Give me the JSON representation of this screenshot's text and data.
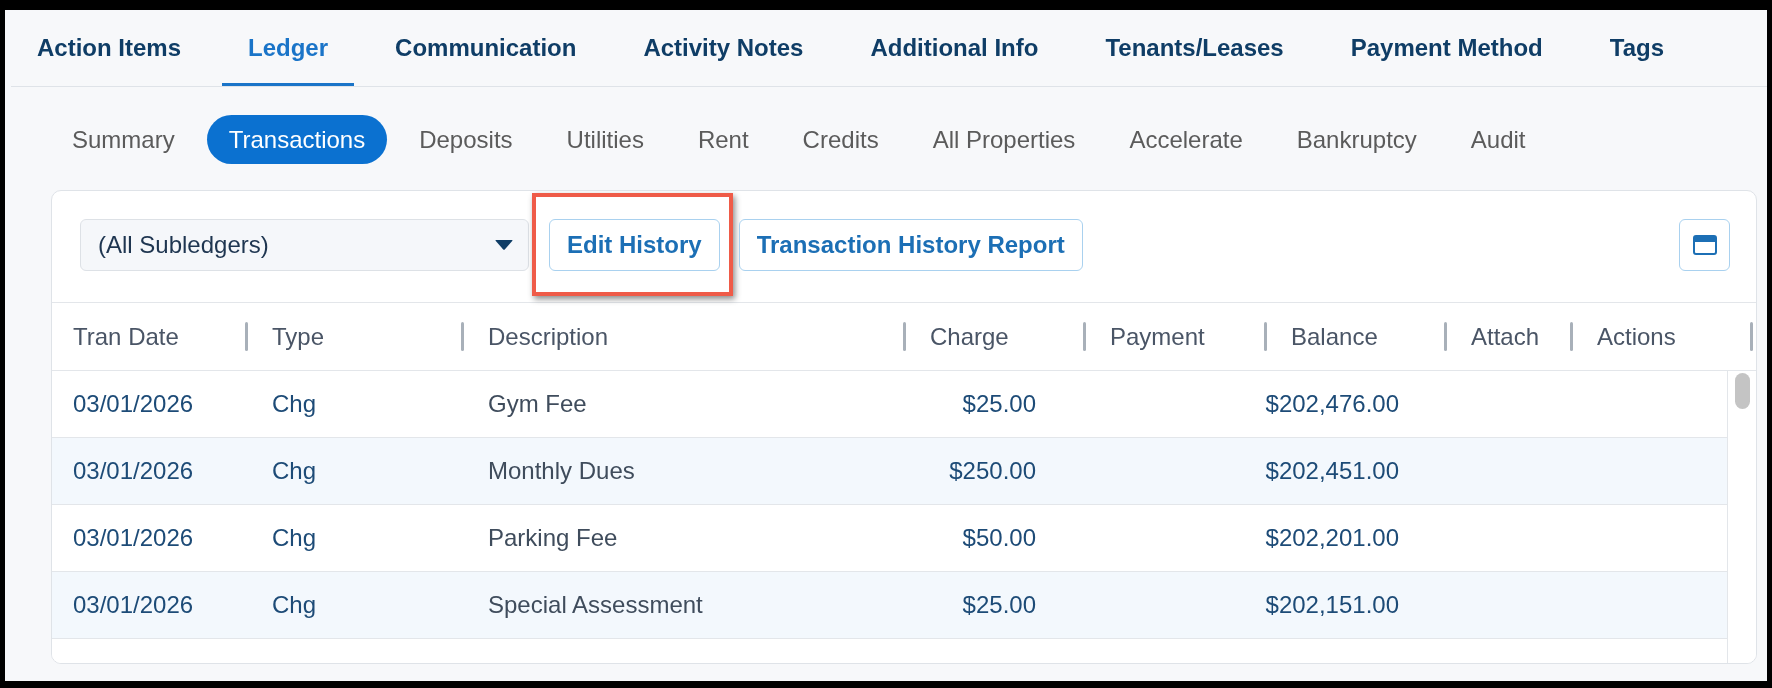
{
  "primary_tabs": [
    {
      "label": "Action Items",
      "selected": false
    },
    {
      "label": "Ledger",
      "selected": true
    },
    {
      "label": "Communication",
      "selected": false
    },
    {
      "label": "Activity Notes",
      "selected": false
    },
    {
      "label": "Additional Info",
      "selected": false
    },
    {
      "label": "Tenants/Leases",
      "selected": false
    },
    {
      "label": "Payment Method",
      "selected": false
    },
    {
      "label": "Tags",
      "selected": false
    }
  ],
  "secondary_tabs": [
    {
      "label": "Summary",
      "selected": false
    },
    {
      "label": "Transactions",
      "selected": true
    },
    {
      "label": "Deposits",
      "selected": false
    },
    {
      "label": "Utilities",
      "selected": false
    },
    {
      "label": "Rent",
      "selected": false
    },
    {
      "label": "Credits",
      "selected": false
    },
    {
      "label": "All Properties",
      "selected": false
    },
    {
      "label": "Accelerate",
      "selected": false
    },
    {
      "label": "Bankruptcy",
      "selected": false
    },
    {
      "label": "Audit",
      "selected": false
    }
  ],
  "toolbar": {
    "subledger_select": {
      "value": "(All Subledgers)"
    },
    "buttons": [
      {
        "label": "Edit History",
        "highlighted": true
      },
      {
        "label": "Transaction History Report",
        "highlighted": false
      }
    ]
  },
  "table": {
    "columns": [
      "Tran Date",
      "Type",
      "Description",
      "Charge",
      "Payment",
      "Balance",
      "Attach",
      "Actions"
    ],
    "rows": [
      {
        "tran_date": "03/01/2026",
        "type": "Chg",
        "description": "Gym Fee",
        "charge": "$25.00",
        "balance": "$202,476.00"
      },
      {
        "tran_date": "03/01/2026",
        "type": "Chg",
        "description": "Monthly Dues",
        "charge": "$250.00",
        "balance": "$202,451.00"
      },
      {
        "tran_date": "03/01/2026",
        "type": "Chg",
        "description": "Parking Fee",
        "charge": "$50.00",
        "balance": "$202,201.00"
      },
      {
        "tran_date": "03/01/2026",
        "type": "Chg",
        "description": "Special Assessment",
        "charge": "$25.00",
        "balance": "$202,151.00"
      }
    ]
  }
}
